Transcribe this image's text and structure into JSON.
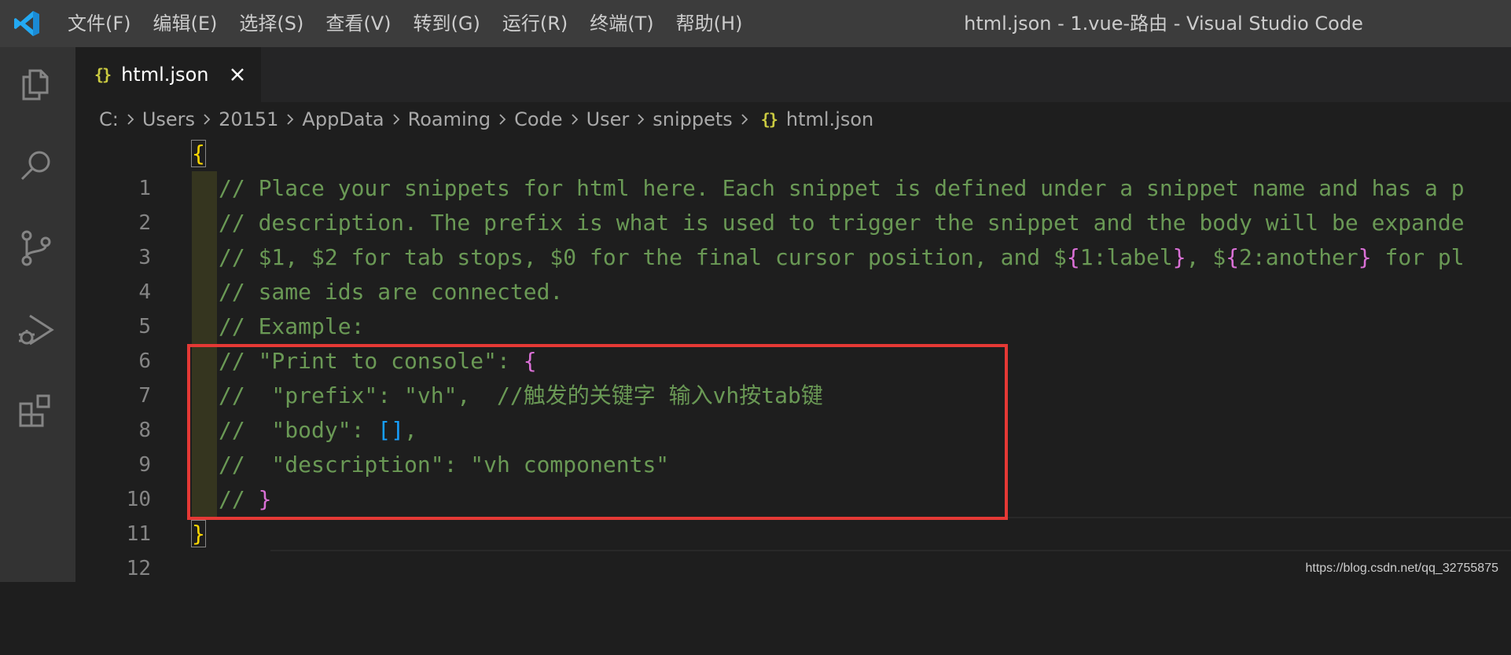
{
  "titlebar": {
    "menu": [
      "文件(F)",
      "编辑(E)",
      "选择(S)",
      "查看(V)",
      "转到(G)",
      "运行(R)",
      "终端(T)",
      "帮助(H)"
    ],
    "window_title": "html.json - 1.vue-路由 - Visual Studio Code"
  },
  "activitybar": {
    "icons": [
      "explorer-icon",
      "search-icon",
      "source-control-icon",
      "run-debug-icon",
      "extensions-icon"
    ]
  },
  "tab": {
    "icon": "{}",
    "label": "html.json",
    "close_icon": "close-icon"
  },
  "breadcrumb": {
    "items": [
      "C:",
      "Users",
      "20151",
      "AppData",
      "Roaming",
      "Code",
      "User",
      "snippets"
    ],
    "file_icon": "{}",
    "file": "html.json"
  },
  "editor": {
    "line_numbers": [
      "1",
      "2",
      "3",
      "4",
      "5",
      "6",
      "7",
      "8",
      "9",
      "10",
      "11",
      "12"
    ],
    "lines": {
      "l1": "{",
      "l2": "// Place your snippets for html here. Each snippet is defined under a snippet name and has a p",
      "l3": "// description. The prefix is what is used to trigger the snippet and the body will be expande",
      "l4a": "// $1, $2 for tab stops, $0 for the final cursor position, and $",
      "l4b": "{",
      "l4c": "1:label",
      "l4d": "}",
      "l4e": ", $",
      "l4f": "{",
      "l4g": "2:another",
      "l4h": "}",
      "l4i": " for pl",
      "l5": "// same ids are connected.",
      "l6": "// Example:",
      "l7a": "// \"Print to console\": ",
      "l7b": "{",
      "l8": "//  \"prefix\": \"vh\",  //触发的关键字 输入vh按tab键",
      "l9a": "//  \"body\": ",
      "l9b": "[]",
      "l9c": ",",
      "l10": "//  \"description\": \"vh components\"",
      "l11a": "// ",
      "l11b": "}",
      "l12": "}"
    }
  },
  "watermark": "https://blog.csdn.net/qq_32755875",
  "colors": {
    "comment": "#6a9955",
    "highlight_box": "#e53935",
    "bracket_gold": "#ffd700",
    "bracket_purple": "#da70d6",
    "bracket_blue": "#179fff"
  }
}
